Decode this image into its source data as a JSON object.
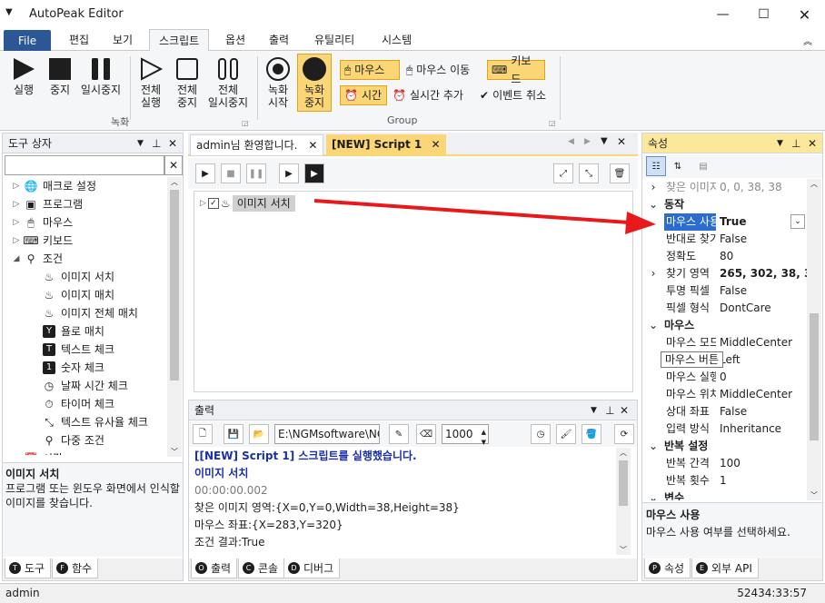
{
  "app": {
    "title": "AutoPeak Editor"
  },
  "menu": {
    "file": "File",
    "tabs": [
      "편집",
      "보기",
      "스크립트",
      "옵션",
      "출력",
      "유틸리티",
      "시스템"
    ]
  },
  "ribbon": {
    "record_group": {
      "label": "녹화",
      "buttons": [
        "실행",
        "중지",
        "일시중지",
        "전체\n실행",
        "전체\n중지",
        "전체\n일시중지"
      ]
    },
    "group2": {
      "label": "Group",
      "rec_start": "녹화\n시작",
      "rec_stop": "녹화\n중지",
      "mouse": "마우스",
      "mouse_move": "마우스 이동",
      "keyboard": "키보드",
      "time": "시간",
      "realtime_add": "실시간 추가",
      "event_cancel": "이벤트 취소"
    }
  },
  "toolbox": {
    "title": "도구 상자",
    "search_value": "",
    "items": [
      {
        "label": "매크로 설정",
        "icon": "globe-icon",
        "level": 0,
        "caret": "▷"
      },
      {
        "label": "프로그램",
        "icon": "program-icon",
        "level": 0,
        "caret": "▷"
      },
      {
        "label": "마우스",
        "icon": "mouse-icon",
        "level": 0,
        "caret": "▷"
      },
      {
        "label": "키보드",
        "icon": "keyboard-icon",
        "level": 0,
        "caret": "▷"
      },
      {
        "label": "조건",
        "icon": "condition-icon",
        "level": 0,
        "caret": "◢"
      },
      {
        "label": "이미지 서치",
        "icon": "image-search-icon",
        "level": 1,
        "caret": ""
      },
      {
        "label": "이미지 매치",
        "icon": "image-match-icon",
        "level": 1,
        "caret": ""
      },
      {
        "label": "이미지 전체 매치",
        "icon": "image-full-match-icon",
        "level": 1,
        "caret": ""
      },
      {
        "label": "욜로 매치",
        "icon": "yolo-icon",
        "level": 1,
        "caret": ""
      },
      {
        "label": "텍스트 체크",
        "icon": "text-check-icon",
        "level": 1,
        "caret": ""
      },
      {
        "label": "숫자 체크",
        "icon": "number-check-icon",
        "level": 1,
        "caret": ""
      },
      {
        "label": "날짜 시간 체크",
        "icon": "datetime-icon",
        "level": 1,
        "caret": ""
      },
      {
        "label": "타이머 체크",
        "icon": "timer-icon",
        "level": 1,
        "caret": ""
      },
      {
        "label": "텍스트 유사율 체크",
        "icon": "similarity-icon",
        "level": 1,
        "caret": ""
      },
      {
        "label": "다중 조건",
        "icon": "multi-condition-icon",
        "level": 1,
        "caret": ""
      },
      {
        "label": "시간",
        "icon": "time-icon",
        "level": 0,
        "caret": "▷"
      }
    ],
    "desc_title": "이미지 서치",
    "desc_text": "프로그램 또는 윈도우 화면에서 인식할 이미지를 찾습니다.",
    "tabs": [
      {
        "badge": "T",
        "label": "도구"
      },
      {
        "badge": "F",
        "label": "함수"
      }
    ]
  },
  "editor": {
    "tabs": [
      "admin님 환영합니다.",
      "[NEW] Script 1"
    ],
    "node_label": "이미지 서치"
  },
  "output": {
    "title": "출력",
    "path": "E:\\NGMsoftware\\NG",
    "spin_value": "1000",
    "lines": [
      {
        "text": "[[NEW] Script 1] 스크립트를 실행했습니다.",
        "color": "#1a2fa8",
        "bold": true
      },
      {
        "text": "이미지 서치",
        "color": "#1a2fa8",
        "bold": true
      },
      {
        "text": "00:00:00.002",
        "color": "#7a7a7a",
        "bold": false
      },
      {
        "text": "찾은 이미지 영역:{X=0,Y=0,Width=38,Height=38}",
        "color": "#1e1e1e",
        "bold": false
      },
      {
        "text": "마우스 좌표:{X=283,Y=320}",
        "color": "#1e1e1e",
        "bold": false
      },
      {
        "text": "조건 결과:True",
        "color": "#1e1e1e",
        "bold": false
      }
    ],
    "tabs": [
      {
        "badge": "O",
        "label": "출력"
      },
      {
        "badge": "C",
        "label": "콘솔"
      },
      {
        "badge": "D",
        "label": "디버그"
      }
    ]
  },
  "properties": {
    "title": "속성",
    "rows": [
      {
        "type": "row",
        "key": "찾은 이미지",
        "value": "0, 0, 38, 38",
        "dim": true,
        "expander": "›"
      },
      {
        "type": "cat",
        "label": "동작"
      },
      {
        "type": "row",
        "key": "마우스 사용",
        "value": "True",
        "selected": true,
        "bold": true
      },
      {
        "type": "row",
        "key": "반대로 찾기",
        "value": "False"
      },
      {
        "type": "row",
        "key": "정확도",
        "value": "80"
      },
      {
        "type": "row",
        "key": "찾기 영역",
        "value": "265, 302, 38, 38",
        "bold": true,
        "expander": "›"
      },
      {
        "type": "row",
        "key": "투명 픽셀",
        "value": "False"
      },
      {
        "type": "row",
        "key": "픽셀 형식",
        "value": "DontCare"
      },
      {
        "type": "cat",
        "label": "마우스"
      },
      {
        "type": "row",
        "key": "마우스 모드",
        "value": "MiddleCenter"
      },
      {
        "type": "row",
        "key": "마우스 버튼",
        "value": "Left"
      },
      {
        "type": "row",
        "key": "마우스 실행",
        "value": "0"
      },
      {
        "type": "row",
        "key": "마우스 위치",
        "value": "MiddleCenter"
      },
      {
        "type": "row",
        "key": "상대 좌표",
        "value": "False"
      },
      {
        "type": "row",
        "key": "입력 방식",
        "value": "Inheritance"
      },
      {
        "type": "cat",
        "label": "반복 설정"
      },
      {
        "type": "row",
        "key": "반복 간격",
        "value": "100"
      },
      {
        "type": "row",
        "key": "반복 횟수",
        "value": "1"
      },
      {
        "type": "cat",
        "label": "변수"
      }
    ],
    "tooltip": "마우스 버튼",
    "desc_title": "마우스 사용",
    "desc_text": "마우스 사용 여부를 선택하세요.",
    "tabs": [
      {
        "badge": "P",
        "label": "속성"
      },
      {
        "badge": "E",
        "label": "외부 API"
      }
    ]
  },
  "status": {
    "user": "admin",
    "clock": "52434:33:57"
  },
  "colors": {
    "accent": "#2b5797",
    "highlight": "#fbd676",
    "arrow": "#e8191b"
  }
}
